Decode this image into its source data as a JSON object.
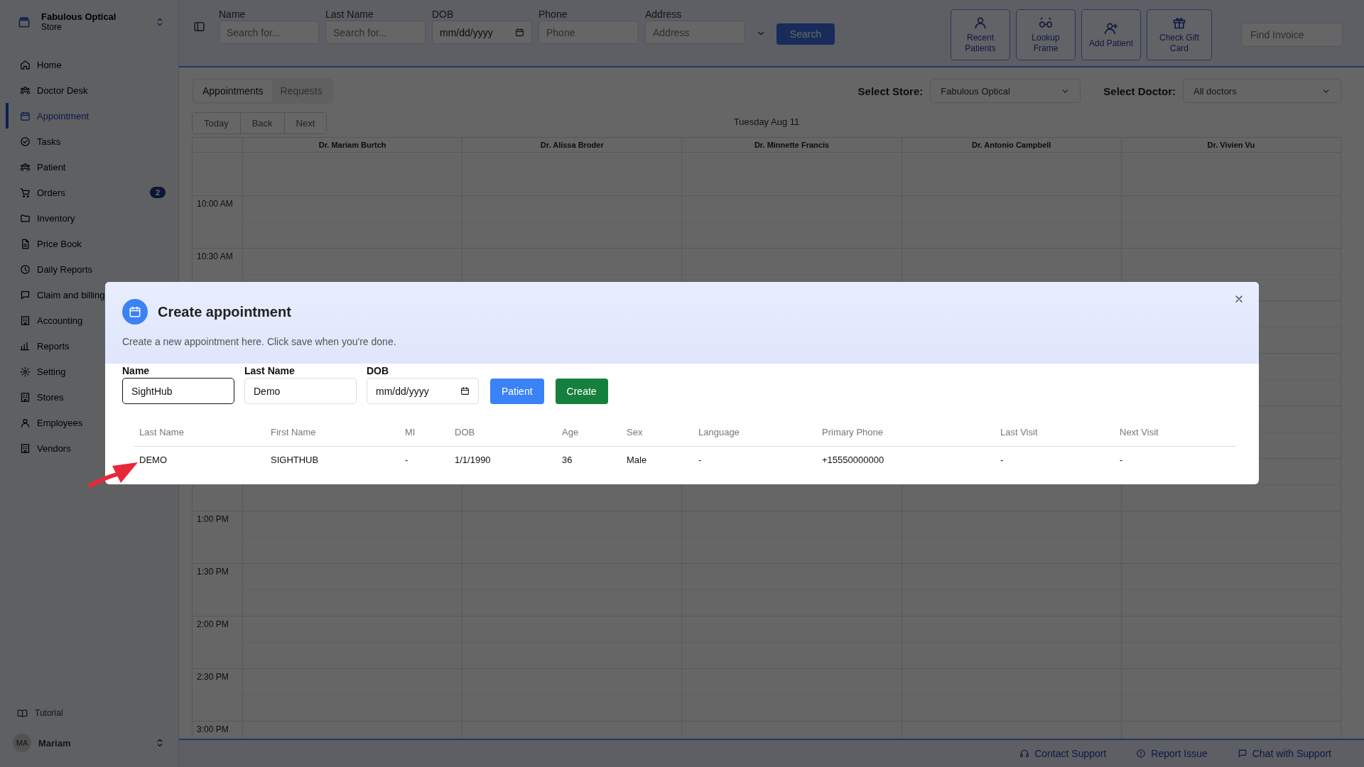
{
  "sidebar": {
    "store": {
      "name": "Fabulous Optical",
      "subtitle": "Store"
    },
    "items": [
      {
        "label": "Home",
        "selected": false
      },
      {
        "label": "Doctor Desk",
        "selected": false
      },
      {
        "label": "Appointment",
        "selected": true
      },
      {
        "label": "Tasks",
        "selected": false
      },
      {
        "label": "Patient",
        "selected": false
      },
      {
        "label": "Orders",
        "selected": false,
        "badge": "2"
      },
      {
        "label": "Inventory",
        "selected": false
      },
      {
        "label": "Price Book",
        "selected": false
      },
      {
        "label": "Daily Reports",
        "selected": false
      },
      {
        "label": "Claim and billing",
        "selected": false
      },
      {
        "label": "Accounting",
        "selected": false
      },
      {
        "label": "Reports",
        "selected": false
      },
      {
        "label": "Setting",
        "selected": false
      },
      {
        "label": "Stores",
        "selected": false
      },
      {
        "label": "Employees",
        "selected": false
      },
      {
        "label": "Vendors",
        "selected": false
      }
    ],
    "tutorial": "Tutorial",
    "user": {
      "initials": "MA",
      "name": "Mariam"
    }
  },
  "search_bar": {
    "fields": [
      {
        "label": "Name",
        "kind": "text",
        "placeholder": "Search for..."
      },
      {
        "label": "Last Name",
        "kind": "text",
        "placeholder": "Search for..."
      },
      {
        "label": "DOB",
        "kind": "date",
        "value": "mm/dd/yyyy"
      },
      {
        "label": "Phone",
        "kind": "text",
        "placeholder": "Phone"
      },
      {
        "label": "Address",
        "kind": "text",
        "placeholder": "Address"
      }
    ],
    "search_button": "Search",
    "actions": [
      {
        "label": "Recent Patients"
      },
      {
        "label": "Lookup Frame"
      },
      {
        "label": "Add Patient"
      },
      {
        "label": "Check Gift Card"
      }
    ],
    "find_invoice": {
      "placeholder": "Find Invoice"
    }
  },
  "calendar": {
    "tabs": [
      {
        "label": "Appointments",
        "selected": true
      },
      {
        "label": "Requests",
        "selected": false
      }
    ],
    "store_select": {
      "label": "Select Store:",
      "value": "Fabulous Optical"
    },
    "doctor_select": {
      "label": "Select Doctor:",
      "value": "All doctors"
    },
    "nav_buttons": [
      "Today",
      "Back",
      "Next"
    ],
    "date": "Tuesday Aug 11",
    "doctors": [
      "Dr. Mariam Burtch",
      "Dr. Alissa Broder",
      "Dr. Minnette Francis",
      "Dr. Antonio Campbell",
      "Dr. Vivien Vu"
    ],
    "time_slots": [
      "10:00 AM",
      "10:30 AM",
      "1:00 PM",
      "1:30 PM",
      "2:00 PM",
      "2:30 PM",
      "3:00 PM"
    ]
  },
  "modal": {
    "title": "Create appointment",
    "description": "Create a new appointment here. Click save when you're done.",
    "fields": [
      {
        "label": "Name",
        "kind": "text",
        "value": "SightHub",
        "focused": true
      },
      {
        "label": "Last Name",
        "kind": "text",
        "value": "Demo",
        "focused": false
      },
      {
        "label": "DOB",
        "kind": "date",
        "value": "mm/dd/yyyy",
        "focused": false
      }
    ],
    "buttons": [
      {
        "label": "Patient",
        "kind": "primary"
      },
      {
        "label": "Create",
        "kind": "success"
      }
    ],
    "table": {
      "columns": [
        "Last Name",
        "First Name",
        "MI",
        "DOB",
        "Age",
        "Sex",
        "Language",
        "Primary Phone",
        "Last Visit",
        "Next Visit"
      ],
      "rows": [
        [
          "DEMO",
          "SIGHTHUB",
          "-",
          "1/1/1990",
          "36",
          "Male",
          "-",
          "+15550000000",
          "-",
          "-"
        ]
      ]
    }
  },
  "footer": {
    "links": [
      {
        "label": "Contact Support"
      },
      {
        "label": "Report Issue"
      },
      {
        "label": "Chat with Support"
      }
    ]
  }
}
